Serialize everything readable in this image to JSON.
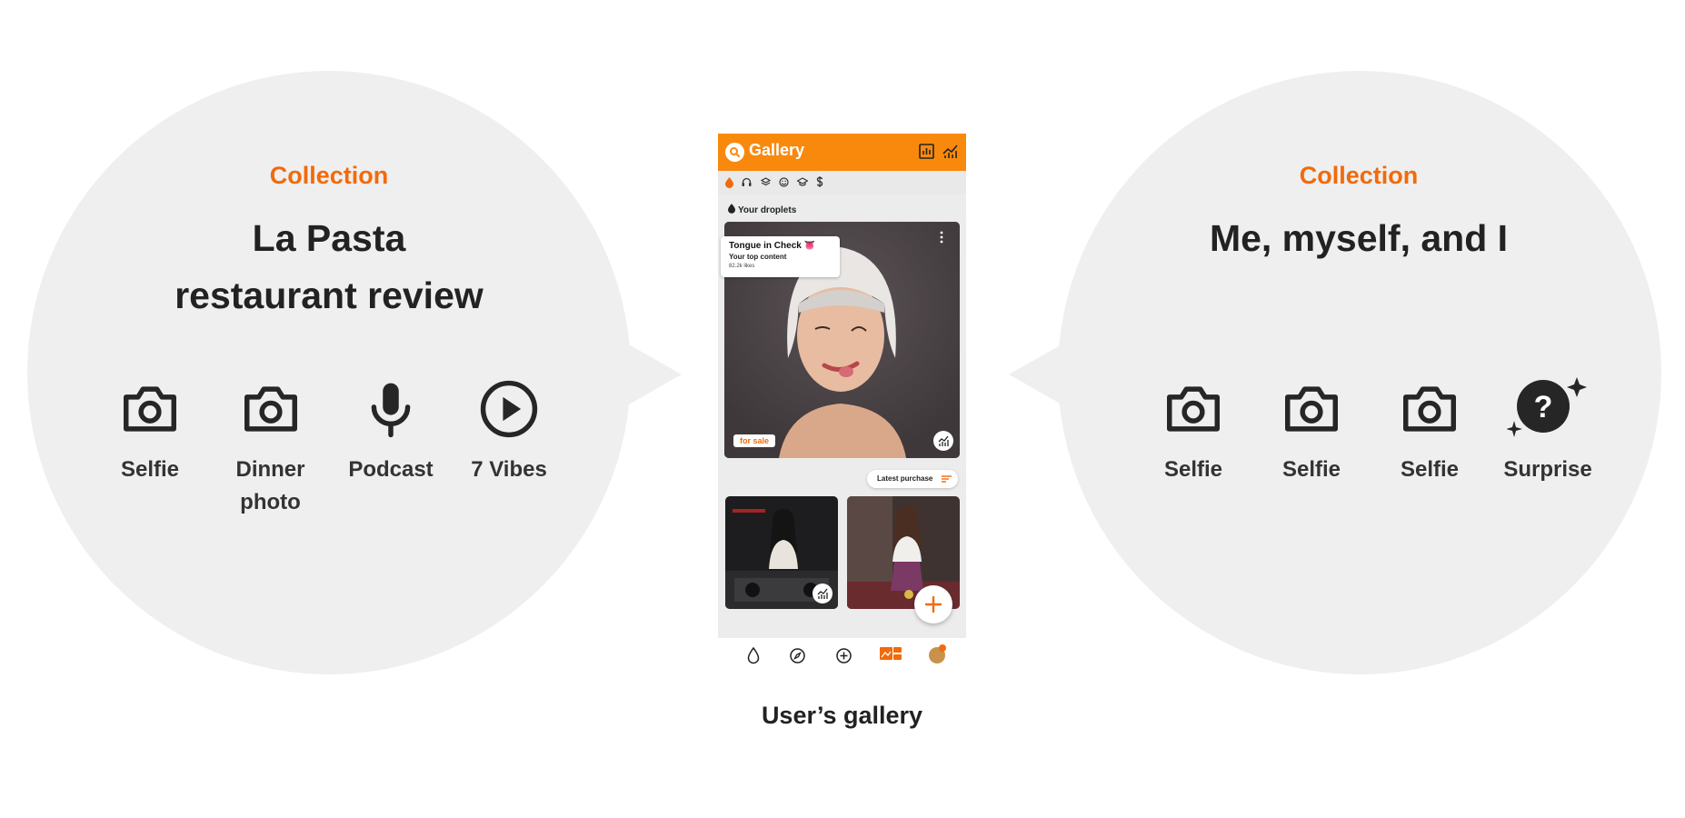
{
  "left_collection": {
    "eyebrow": "Collection",
    "title_line1": "La Pasta",
    "title_line2": "restaurant review",
    "items": [
      {
        "label": "Selfie",
        "icon": "camera-icon"
      },
      {
        "label": "Dinner photo",
        "icon": "camera-icon"
      },
      {
        "label": "Podcast",
        "icon": "microphone-icon"
      },
      {
        "label": "7 Vibes",
        "icon": "play-icon"
      }
    ]
  },
  "right_collection": {
    "eyebrow": "Collection",
    "title": "Me, myself, and I",
    "items": [
      {
        "label": "Selfie",
        "icon": "camera-icon"
      },
      {
        "label": "Selfie",
        "icon": "camera-icon"
      },
      {
        "label": "Selfie",
        "icon": "camera-icon"
      },
      {
        "label": "Surprise",
        "icon": "question-sparkle-icon"
      }
    ]
  },
  "phone": {
    "app_title": "Gallery",
    "filters": [
      "droplet-icon",
      "headphones-icon",
      "layers-icon",
      "smile-icon",
      "graduation-cap-icon",
      "dollar-icon"
    ],
    "section_title": "Your droplets",
    "hero": {
      "card_title": "Tongue in Check 👅",
      "card_subtitle": "Your top content",
      "card_likes": "82.2k likes",
      "sale_label": "for sale"
    },
    "sort_label": "Latest purchase",
    "bottom_nav": [
      "droplet-icon",
      "compass-icon",
      "add-circle-icon",
      "gallery-icon",
      "avatar"
    ]
  },
  "caption": "User’s gallery",
  "colors": {
    "accent": "#f26a0b",
    "appbar": "#f9890d",
    "bubble": "#efefef",
    "text": "#222222"
  }
}
